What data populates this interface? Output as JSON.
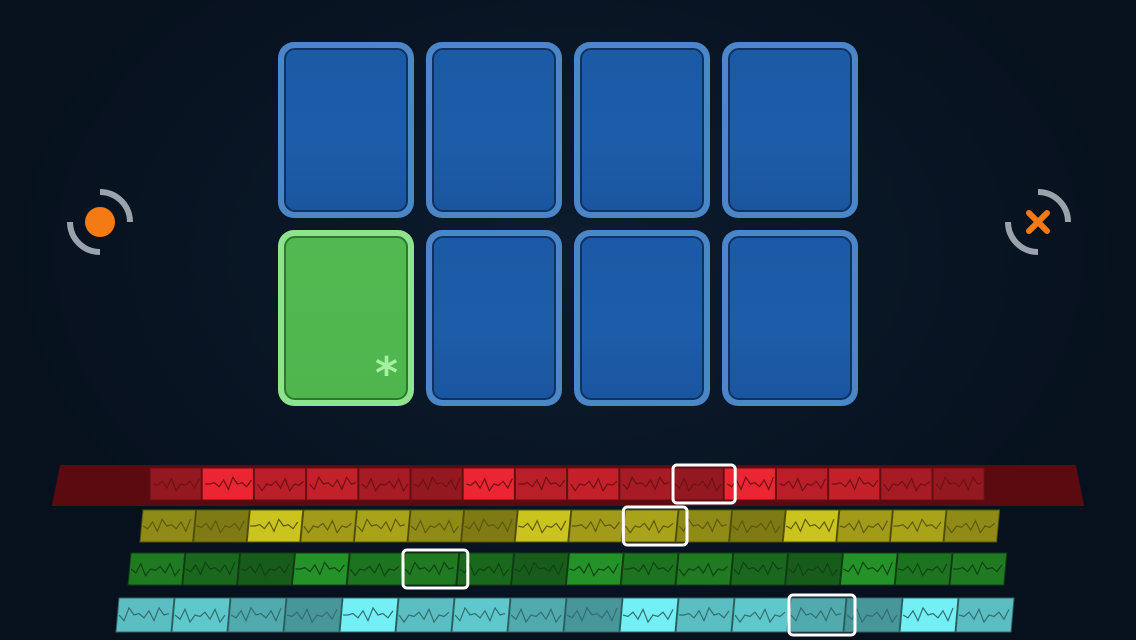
{
  "card_grid": {
    "cards": [
      {
        "id": "card-1",
        "state": "face-down",
        "color": "#1d5ca8"
      },
      {
        "id": "card-2",
        "state": "face-down",
        "color": "#1d5ca8"
      },
      {
        "id": "card-3",
        "state": "face-down",
        "color": "#1d5ca8"
      },
      {
        "id": "card-4",
        "state": "face-down",
        "color": "#1d5ca8"
      },
      {
        "id": "card-5",
        "state": "selected",
        "color": "#4fb64e",
        "mark": "*"
      },
      {
        "id": "card-6",
        "state": "face-down",
        "color": "#1d5ca8"
      },
      {
        "id": "card-7",
        "state": "face-down",
        "color": "#1d5ca8"
      },
      {
        "id": "card-8",
        "state": "face-down",
        "color": "#1d5ca8"
      }
    ]
  },
  "left_control": {
    "icon": "record-icon",
    "color": "#f47a14"
  },
  "right_control": {
    "icon": "close-icon",
    "color": "#f47a14"
  },
  "tracks": [
    {
      "name": "red",
      "color": "#c4202a",
      "segments": 16,
      "active_index": 10
    },
    {
      "name": "yellow",
      "color": "#a9a31a",
      "segments": 16,
      "active_index": 9
    },
    {
      "name": "green",
      "color": "#1f7a22",
      "segments": 16,
      "active_index": 5
    },
    {
      "name": "cyan",
      "color": "#5fc8cc",
      "segments": 16,
      "active_index": 12
    }
  ]
}
